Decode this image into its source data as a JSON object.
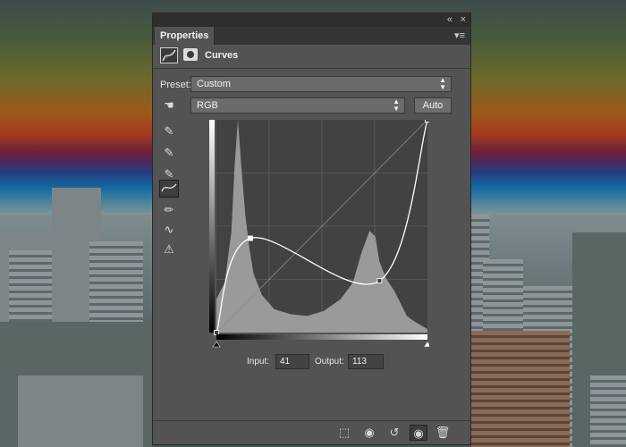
{
  "panel": {
    "collapse_icon": "«",
    "close_icon": "×",
    "tab_label": "Properties",
    "menu_icon": "▾≡",
    "adjustment_title": "Curves",
    "preset_label": "Preset:",
    "preset_value": "Custom",
    "channel_value": "RGB",
    "auto_label": "Auto",
    "input_label": "Input:",
    "input_value": "41",
    "output_label": "Output:",
    "output_value": "113"
  },
  "tools": [
    "targeted-adjust-icon",
    "black-point-eyedropper-icon",
    "gray-point-eyedropper-icon",
    "white-point-eyedropper-icon",
    "curve-points-icon",
    "pencil-icon",
    "smooth-icon",
    "clipping-warning-icon"
  ],
  "bottom_icons": [
    "clip-to-layer-icon",
    "view-previous-state-icon",
    "reset-icon",
    "visibility-eye-icon",
    "trash-icon"
  ],
  "chart_data": {
    "type": "area",
    "x_range": [
      0,
      255
    ],
    "y_range": [
      0,
      255
    ],
    "grid": "4x4 quarter grid",
    "histogram": [
      [
        0,
        40
      ],
      [
        10,
        60
      ],
      [
        18,
        120
      ],
      [
        22,
        200
      ],
      [
        26,
        255
      ],
      [
        30,
        200
      ],
      [
        35,
        140
      ],
      [
        40,
        100
      ],
      [
        45,
        70
      ],
      [
        55,
        45
      ],
      [
        70,
        28
      ],
      [
        90,
        22
      ],
      [
        110,
        20
      ],
      [
        130,
        26
      ],
      [
        150,
        40
      ],
      [
        165,
        60
      ],
      [
        175,
        95
      ],
      [
        185,
        122
      ],
      [
        192,
        115
      ],
      [
        197,
        85
      ],
      [
        205,
        65
      ],
      [
        215,
        50
      ],
      [
        222,
        36
      ],
      [
        230,
        20
      ],
      [
        238,
        14
      ],
      [
        245,
        10
      ],
      [
        255,
        4
      ]
    ],
    "curve_points": [
      [
        0,
        0
      ],
      [
        41,
        113
      ],
      [
        197,
        62
      ],
      [
        255,
        255
      ]
    ]
  }
}
